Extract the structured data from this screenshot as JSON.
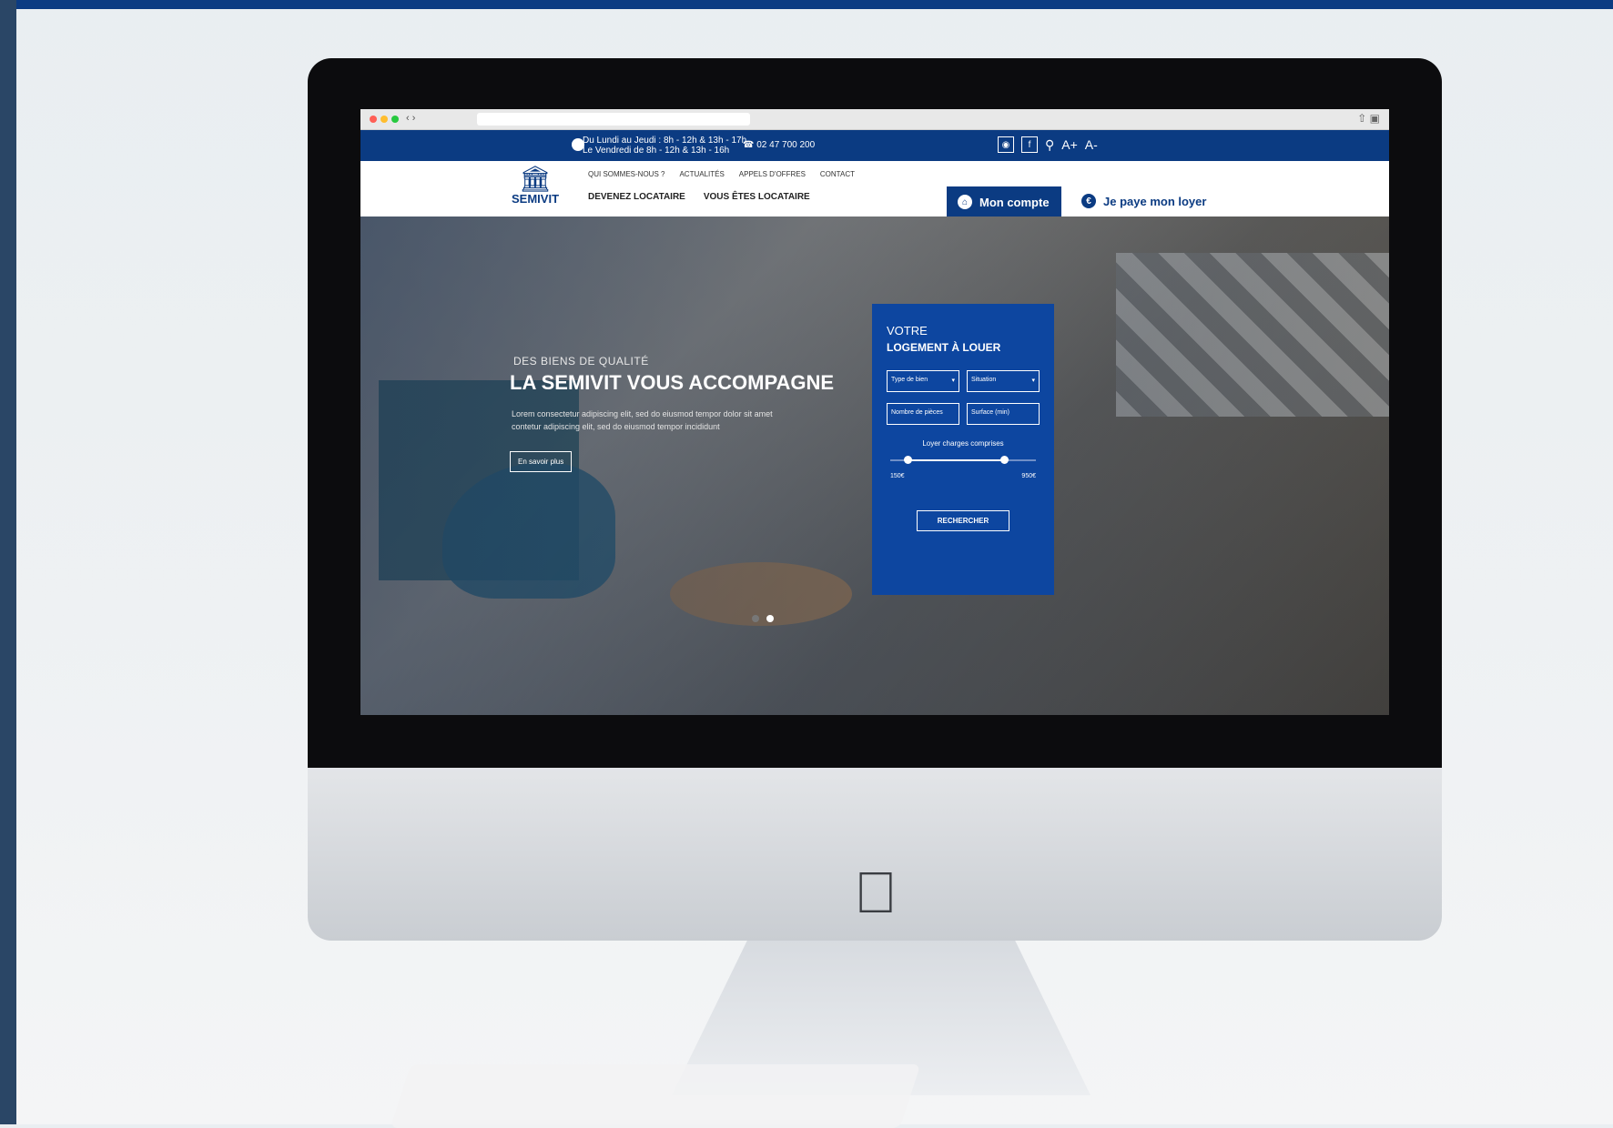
{
  "browser": {
    "nav_buttons": "‹ ›"
  },
  "infobar": {
    "hours_line1": "Du Lundi au Jeudi : 8h - 12h & 13h - 17h",
    "hours_line2": "Le Vendredi de 8h - 12h & 13h - 16h",
    "phone": "02 47 700 200",
    "instagram_icon": "instagram-icon",
    "facebook_label": "f",
    "font_increase": "A+",
    "font_decrease": "A-"
  },
  "brand": {
    "name": "SEMIVIT"
  },
  "nav": {
    "top": [
      "QUI SOMMES-NOUS ?",
      "ACTUALITÉS",
      "APPELS D'OFFRES",
      "CONTACT"
    ],
    "main": [
      "DEVENEZ LOCATAIRE",
      "VOUS ÊTES LOCATAIRE"
    ],
    "mon_compte": "Mon compte",
    "je_paye": "Je paye mon loyer"
  },
  "hero": {
    "kicker": "DES BIENS DE QUALITÉ",
    "headline": "LA SEMIVIT VOUS ACCOMPAGNE",
    "body": "Lorem consectetur adipiscing elit, sed do eiusmod tempor dolor sit amet contetur adipiscing elit, sed do eiusmod tempor incididunt",
    "cta": "En savoir plus",
    "slides": 2,
    "active_slide": 1
  },
  "search": {
    "title1": "VOTRE",
    "title2": "LOGEMENT À LOUER",
    "type_de_bien": "Type de bien",
    "situation": "Situation",
    "nombre_pieces": "Nombre de pièces",
    "surface": "Surface (min)",
    "range_label": "Loyer charges comprises",
    "min": "150€",
    "max": "950€",
    "range_fraction_start": 0.12,
    "range_fraction_end": 0.78,
    "button": "RECHERCHER"
  },
  "colors": {
    "brand_blue": "#0b3b82",
    "panel_blue": "#0d46a0"
  }
}
